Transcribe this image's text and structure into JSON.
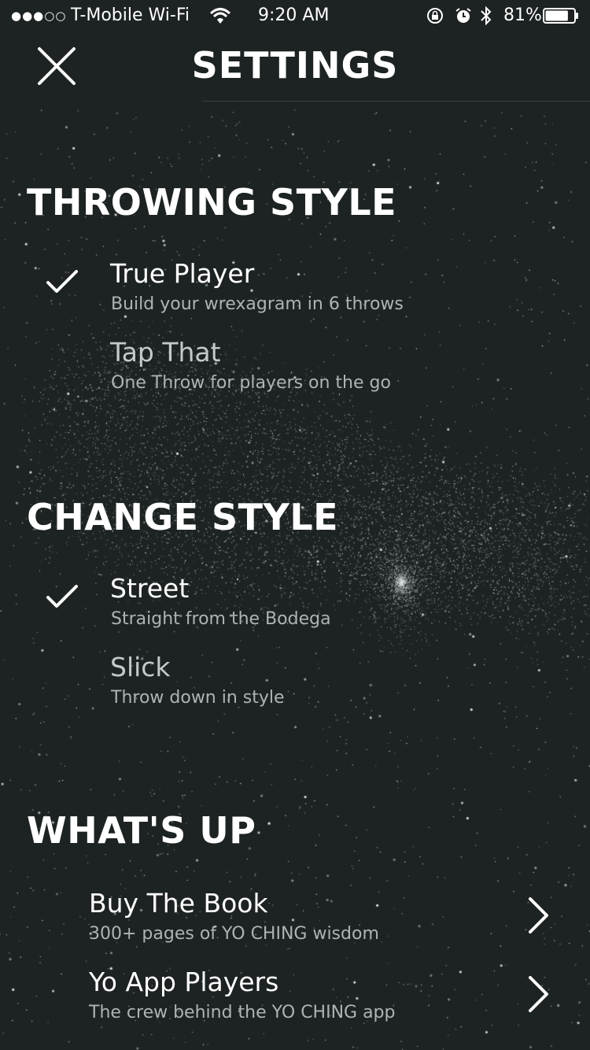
{
  "status_bar": {
    "signal": "●●●○○",
    "carrier": "T-Mobile Wi-Fi",
    "time": "9:20 AM",
    "battery_percent": "81%",
    "battery_level": 0.81,
    "icons": [
      "wifi-icon",
      "rotation-lock-icon",
      "alarm-icon",
      "bluetooth-icon",
      "battery-icon"
    ]
  },
  "header": {
    "title": "SETTINGS",
    "close_icon": "close-icon"
  },
  "throwing_style": {
    "title": "THROWING STYLE",
    "options": [
      {
        "title": "True Player",
        "subtitle": "Build your wrexagram in 6 throws",
        "selected": true
      },
      {
        "title": "Tap That",
        "subtitle": "One Throw for players on the go",
        "selected": false
      }
    ]
  },
  "change_style": {
    "title": "CHANGE STYLE",
    "options": [
      {
        "title": "Street",
        "subtitle": "Straight from the Bodega",
        "selected": true
      },
      {
        "title": "Slick",
        "subtitle": "Throw down in style",
        "selected": false
      }
    ]
  },
  "whats_up": {
    "title": "WHAT'S UP",
    "items": [
      {
        "title": "Buy The Book",
        "subtitle": "300+ pages of YO CHING wisdom",
        "icon": "chevron-right-icon"
      },
      {
        "title": "Yo App Players",
        "subtitle": "The crew behind the YO CHING app",
        "icon": "chevron-right-icon"
      }
    ]
  },
  "colors": {
    "background": "#1d2223",
    "text": "#ffffff",
    "subtext": "#aeb4b4"
  }
}
